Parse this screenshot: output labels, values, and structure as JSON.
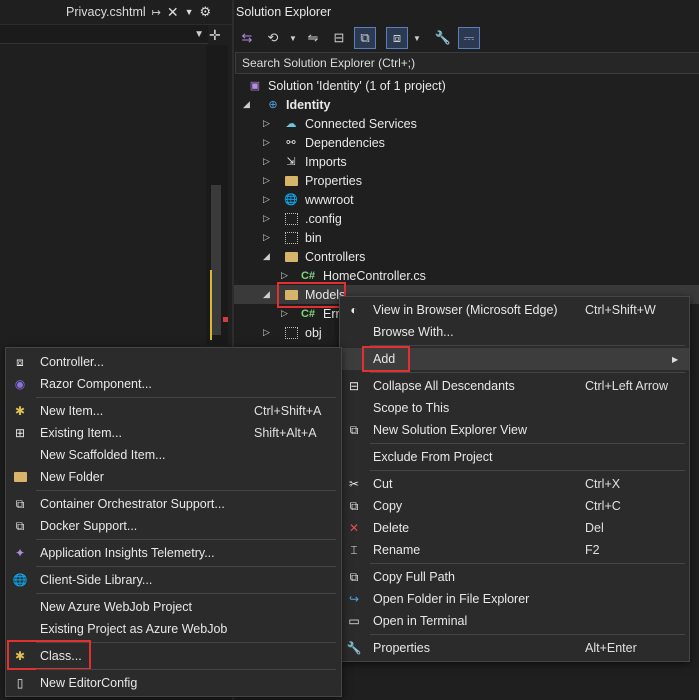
{
  "editor": {
    "tab_title": "Privacy.cshtml",
    "pin_icon": "pin-icon",
    "close_icon": "close-icon",
    "dropdown_icon": "chevron-down-icon",
    "settings_icon": "gear-icon"
  },
  "solution_explorer": {
    "title": "Solution Explorer",
    "search_placeholder": "Search Solution Explorer (Ctrl+;)",
    "tree": [
      {
        "label": "Solution 'Identity' (1 of 1 project)",
        "icon": "solution-icon"
      },
      {
        "label": "Identity",
        "icon": "web-project-icon"
      },
      {
        "label": "Connected Services",
        "icon": "cloud-icon"
      },
      {
        "label": "Dependencies",
        "icon": "dependencies-icon"
      },
      {
        "label": "Imports",
        "icon": "imports-icon"
      },
      {
        "label": "Properties",
        "icon": "properties-folder-icon"
      },
      {
        "label": "wwwroot",
        "icon": "globe-icon"
      },
      {
        "label": ".config",
        "icon": "folder-dotted-icon"
      },
      {
        "label": "bin",
        "icon": "folder-dotted-icon"
      },
      {
        "label": "Controllers",
        "icon": "folder-icon"
      },
      {
        "label": "HomeController.cs",
        "icon": "csharp-file-icon"
      },
      {
        "label": "Models",
        "icon": "folder-icon"
      },
      {
        "label": "Err",
        "icon": "csharp-file-icon"
      },
      {
        "label": "obj",
        "icon": "folder-dotted-icon"
      }
    ]
  },
  "context_menu": {
    "items": [
      {
        "label": "View in Browser (Microsoft Edge)",
        "shortcut": "Ctrl+Shift+W"
      },
      {
        "label": "Browse With...",
        "shortcut": ""
      },
      {
        "label": "Add",
        "shortcut": ""
      },
      {
        "label": "Collapse All Descendants",
        "shortcut": "Ctrl+Left Arrow"
      },
      {
        "label": "Scope to This",
        "shortcut": ""
      },
      {
        "label": "New Solution Explorer View",
        "shortcut": ""
      },
      {
        "label": "Exclude From Project",
        "shortcut": ""
      },
      {
        "label": "Cut",
        "shortcut": "Ctrl+X"
      },
      {
        "label": "Copy",
        "shortcut": "Ctrl+C"
      },
      {
        "label": "Delete",
        "shortcut": "Del"
      },
      {
        "label": "Rename",
        "shortcut": "F2"
      },
      {
        "label": "Copy Full Path",
        "shortcut": ""
      },
      {
        "label": "Open Folder in File Explorer",
        "shortcut": ""
      },
      {
        "label": "Open in Terminal",
        "shortcut": ""
      },
      {
        "label": "Properties",
        "shortcut": "Alt+Enter"
      }
    ]
  },
  "add_submenu": {
    "items": [
      {
        "label": "Controller...",
        "shortcut": ""
      },
      {
        "label": "Razor Component...",
        "shortcut": ""
      },
      {
        "label": "New Item...",
        "shortcut": "Ctrl+Shift+A"
      },
      {
        "label": "Existing Item...",
        "shortcut": "Shift+Alt+A"
      },
      {
        "label": "New Scaffolded Item...",
        "shortcut": ""
      },
      {
        "label": "New Folder",
        "shortcut": ""
      },
      {
        "label": "Container Orchestrator Support...",
        "shortcut": ""
      },
      {
        "label": "Docker Support...",
        "shortcut": ""
      },
      {
        "label": "Application Insights Telemetry...",
        "shortcut": ""
      },
      {
        "label": "Client-Side Library...",
        "shortcut": ""
      },
      {
        "label": "New Azure WebJob Project",
        "shortcut": ""
      },
      {
        "label": "Existing Project as Azure WebJob",
        "shortcut": ""
      },
      {
        "label": "Class...",
        "shortcut": ""
      },
      {
        "label": "New EditorConfig",
        "shortcut": ""
      }
    ]
  },
  "colors": {
    "highlight": "#e03030",
    "accent": "#5a7fb8"
  }
}
